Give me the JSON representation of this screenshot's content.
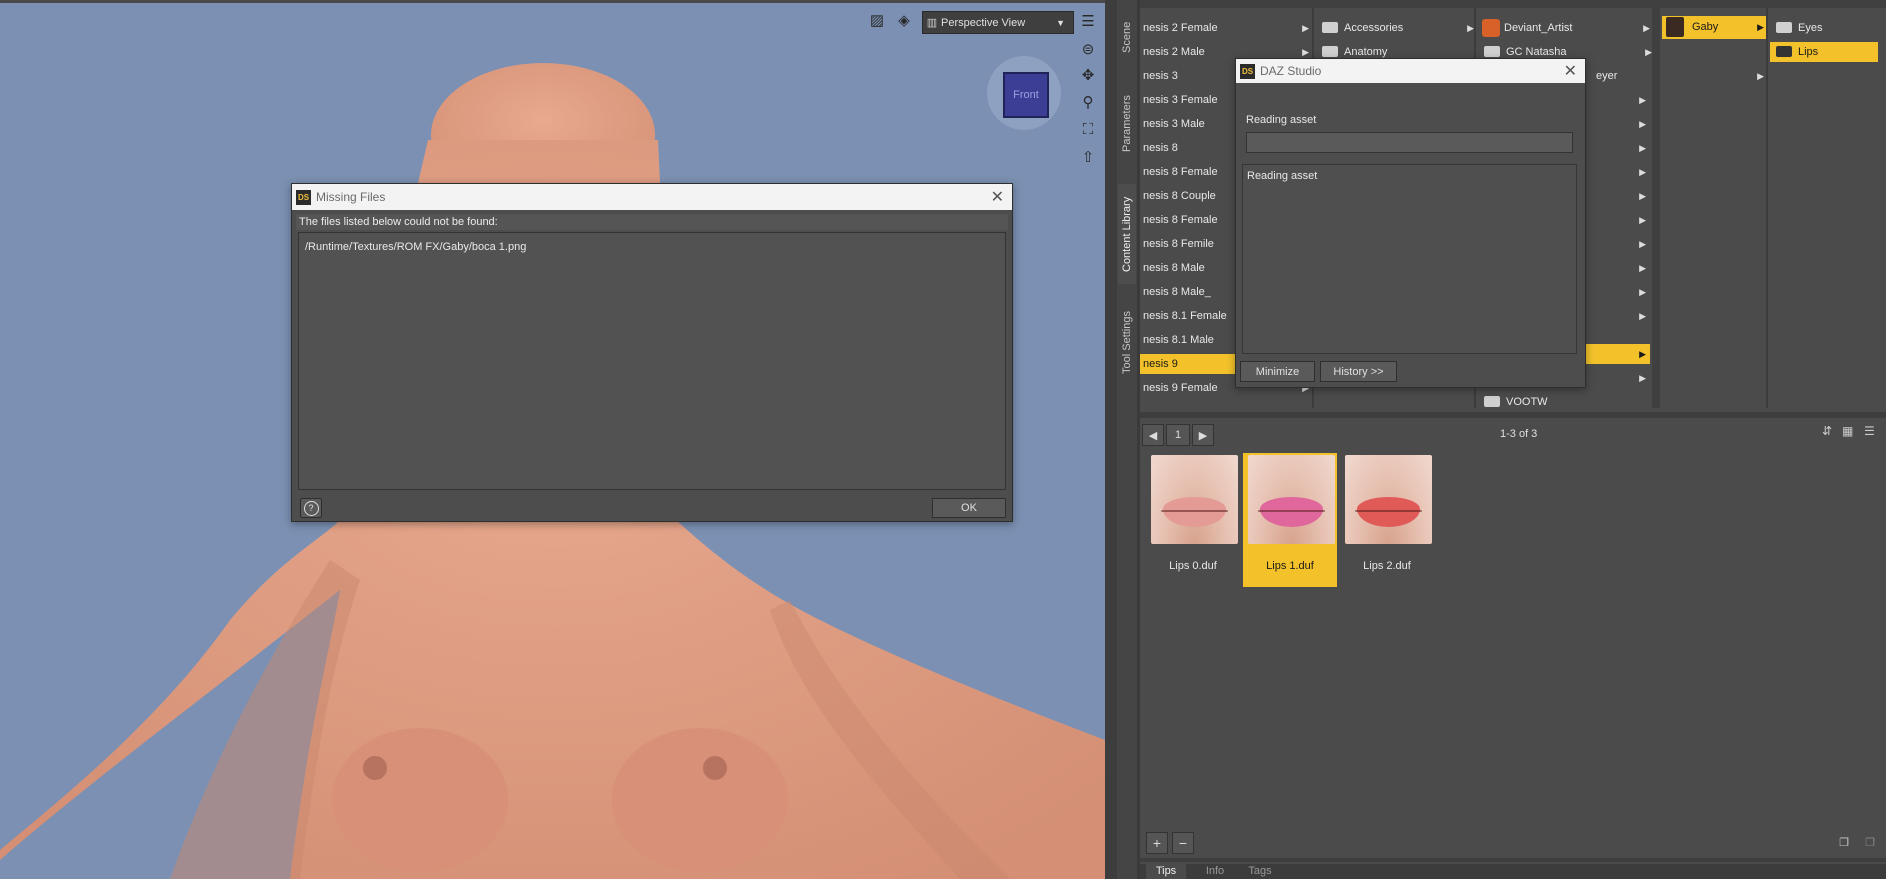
{
  "viewport": {
    "camera_label": "Perspective View",
    "navcube_face": "Front",
    "accent": "#7b90b2"
  },
  "missing_dialog": {
    "title": "Missing Files",
    "message": "The files listed below could not be found:",
    "files": [
      "/Runtime/Textures/ROM FX/Gaby/boca 1.png"
    ],
    "help_label": "?",
    "ok_label": "OK"
  },
  "side_tabs": [
    "Scene",
    "Parameters",
    "Content Library",
    "Tool Settings"
  ],
  "library": {
    "col1": [
      "nesis 2 Female",
      "nesis 2 Male",
      "nesis 3",
      "nesis 3 Female",
      "nesis 3 Male",
      "nesis 8",
      "nesis 8  Female",
      "nesis 8 Couple",
      "nesis 8 Female",
      "nesis 8 Femile",
      "nesis 8 Male",
      "nesis 8 Male_",
      "nesis 8.1 Female",
      "nesis 8.1 Male",
      "nesis 9",
      "nesis 9 Female"
    ],
    "col1_selected": "nesis 9",
    "col2": [
      "Accessories",
      "Anatomy"
    ],
    "col3": [
      "Deviant_Artist",
      "GC Natasha",
      "eyer",
      "VOOTW"
    ],
    "col4": [
      "Gaby"
    ],
    "col5": [
      "Eyes",
      "Lips"
    ],
    "col5_selected": "Lips",
    "selection_color": "#f3c22b"
  },
  "daz_dialog": {
    "title": "DAZ Studio",
    "status": "Reading asset",
    "log": "Reading asset",
    "minimize_label": "Minimize",
    "history_label": "History >>"
  },
  "browser": {
    "page": "1",
    "count": "1-3 of 3",
    "items": [
      {
        "label": "Lips 0.duf",
        "lip_color": "#e49a95"
      },
      {
        "label": "Lips 1.duf",
        "lip_color": "#e0679c"
      },
      {
        "label": "Lips 2.duf",
        "lip_color": "#e05a58"
      }
    ],
    "selected": "Lips 1.duf"
  },
  "bottom_tabs": [
    "Tips",
    "Info",
    "Tags"
  ]
}
